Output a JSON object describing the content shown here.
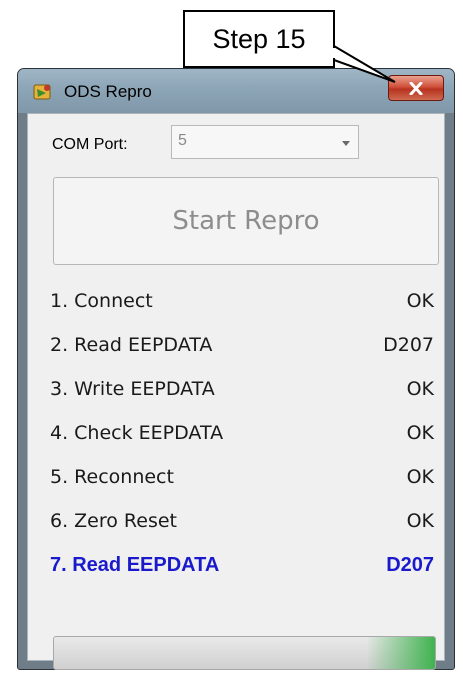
{
  "callout": {
    "text": "Step 15"
  },
  "window": {
    "title": "ODS Repro",
    "icon": "app-icon",
    "close_icon": "close-icon"
  },
  "com_port": {
    "label": "COM Port:",
    "value": "5"
  },
  "start_button": {
    "label": "Start Repro"
  },
  "steps": [
    {
      "label": "1. Connect",
      "status": "OK"
    },
    {
      "label": "2. Read EEPDATA",
      "status": "D207"
    },
    {
      "label": "3. Write EEPDATA",
      "status": "OK"
    },
    {
      "label": "4. Check EEPDATA",
      "status": "OK"
    },
    {
      "label": "5. Reconnect",
      "status": "OK"
    },
    {
      "label": "6. Zero Reset",
      "status": "OK"
    },
    {
      "label": "7. Read EEPDATA",
      "status": "D207"
    }
  ],
  "progress": {
    "value": 1.0
  },
  "colors": {
    "active_step": "#1a1acc",
    "close_button": "#c94a35",
    "progress_fill": "#3fb34f"
  }
}
